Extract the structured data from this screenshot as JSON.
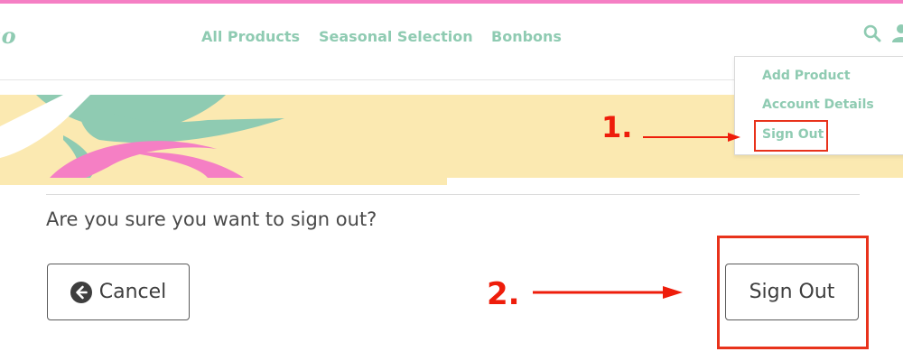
{
  "header": {
    "logo_text": "co",
    "nav": [
      {
        "label": "All Products"
      },
      {
        "label": "Seasonal Selection"
      },
      {
        "label": "Bonbons"
      }
    ],
    "icons": [
      "search-icon",
      "user-icon"
    ]
  },
  "dropdown": {
    "items": [
      {
        "label": "Add Product"
      },
      {
        "label": "Account Details"
      },
      {
        "label": "Sign Out"
      }
    ]
  },
  "annotations": {
    "step1": "1.",
    "step2": "2.",
    "highlight_color": "#e8321b",
    "label_color": "#ee1d0b"
  },
  "main": {
    "question": "Are you sure you want to sign out?",
    "cancel_label": "Cancel",
    "cancel_icon": "circle-arrow-left-icon",
    "signout_label": "Sign Out"
  },
  "colors": {
    "accent": "#8fcbb2",
    "top_stripe": "#f57fc4",
    "banner_bg": "#fbe9b1",
    "text": "#4a4a4a"
  }
}
